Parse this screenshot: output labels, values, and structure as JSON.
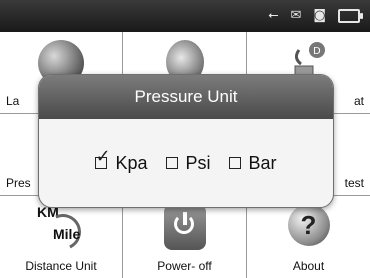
{
  "status_bar": {
    "icons": [
      "usb-icon",
      "mail-icon",
      "cassette-icon",
      "battery-icon"
    ]
  },
  "menu": {
    "items": [
      {
        "label": "La",
        "icon": "globe-icon"
      },
      {
        "label": "",
        "icon": "speaker-icon"
      },
      {
        "label": "at",
        "icon": "reset-icon"
      },
      {
        "label": "Pres",
        "icon": "pressure-gauge-icon"
      },
      {
        "label": "",
        "icon": ""
      },
      {
        "label": "test",
        "icon": "wrench-icon"
      },
      {
        "label": "Distance Unit",
        "icon": "km-mile-icon"
      },
      {
        "label": "Power- off",
        "icon": "power-icon"
      },
      {
        "label": "About",
        "icon": "question-icon"
      }
    ]
  },
  "distance_icon": {
    "top": "KM",
    "bottom": "Mile"
  },
  "about_icon": {
    "glyph": "?"
  },
  "dialog": {
    "title": "Pressure Unit",
    "options": [
      {
        "label": "Kpa",
        "checked": true
      },
      {
        "label": "Psi",
        "checked": false
      },
      {
        "label": "Bar",
        "checked": false
      }
    ]
  }
}
